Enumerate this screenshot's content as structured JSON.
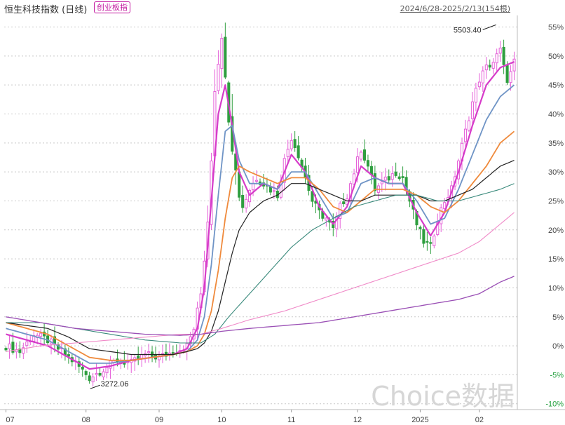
{
  "header": {
    "title": "恒生科技指数 (日线)",
    "badge": "创业板指",
    "range": "2024/6/28-2025/2/13(154根)"
  },
  "watermark": "Choice数据",
  "colors": {
    "up": "#e55fd8",
    "down": "#2e9e3f",
    "ma5": "#d63bc9",
    "ma10": "#6f94c6",
    "ma20": "#ef8a3c",
    "ma30": "#222222",
    "ma60": "#3a8a7c",
    "ma120": "#f08ac8",
    "ma250": "#9a4fb5"
  },
  "chart_data": {
    "type": "candlestick",
    "x_unit": "trading day",
    "y_unit": "% change",
    "ylim": [
      -11,
      57
    ],
    "yticks": [
      {
        "v": 55,
        "label": "55%"
      },
      {
        "v": 50,
        "label": "50%"
      },
      {
        "v": 45,
        "label": "45%"
      },
      {
        "v": 40,
        "label": "40%"
      },
      {
        "v": 35,
        "label": "35%"
      },
      {
        "v": 30,
        "label": "30%"
      },
      {
        "v": 25,
        "label": "25%"
      },
      {
        "v": 20,
        "label": "20%"
      },
      {
        "v": 15,
        "label": "15%"
      },
      {
        "v": 10,
        "label": "10%"
      },
      {
        "v": 5,
        "label": "5%"
      },
      {
        "v": 0,
        "label": "0%"
      },
      {
        "v": -5,
        "label": "-5%"
      },
      {
        "v": -10,
        "label": "-10%"
      }
    ],
    "xticks": [
      {
        "i": 0,
        "label": "07"
      },
      {
        "i": 23,
        "label": "08"
      },
      {
        "i": 44,
        "label": "09"
      },
      {
        "i": 62,
        "label": "10"
      },
      {
        "i": 82,
        "label": "11"
      },
      {
        "i": 101,
        "label": "12"
      },
      {
        "i": 119,
        "label": "2025"
      },
      {
        "i": 136,
        "label": "02"
      }
    ],
    "grid": true,
    "annotations": [
      {
        "label": "5503.40",
        "i": 141,
        "v": 55.5,
        "kind": "high"
      },
      {
        "label": "3272.06",
        "i": 24,
        "v": -7.4,
        "kind": "low"
      }
    ],
    "close_path": [
      [
        0,
        0
      ],
      [
        4,
        -1
      ],
      [
        8,
        2
      ],
      [
        12,
        1
      ],
      [
        16,
        -1
      ],
      [
        20,
        -3
      ],
      [
        24,
        -5.5
      ],
      [
        28,
        -4
      ],
      [
        32,
        -2.5
      ],
      [
        36,
        -3
      ],
      [
        40,
        -1.5
      ],
      [
        44,
        -2
      ],
      [
        48,
        -1
      ],
      [
        50,
        -0.5
      ],
      [
        52,
        0
      ],
      [
        54,
        3
      ],
      [
        56,
        9
      ],
      [
        57,
        15
      ],
      [
        58,
        22
      ],
      [
        59,
        33
      ],
      [
        60,
        45
      ],
      [
        61,
        50
      ],
      [
        62,
        52
      ],
      [
        63,
        48
      ],
      [
        64,
        40
      ],
      [
        65,
        35
      ],
      [
        66,
        30
      ],
      [
        67,
        26
      ],
      [
        68,
        24
      ],
      [
        70,
        27
      ],
      [
        72,
        29
      ],
      [
        74,
        28
      ],
      [
        76,
        27
      ],
      [
        78,
        26
      ],
      [
        80,
        32
      ],
      [
        82,
        36
      ],
      [
        84,
        33
      ],
      [
        86,
        29
      ],
      [
        88,
        25
      ],
      [
        90,
        23
      ],
      [
        92,
        22
      ],
      [
        94,
        20
      ],
      [
        96,
        24
      ],
      [
        98,
        26
      ],
      [
        100,
        30
      ],
      [
        102,
        34
      ],
      [
        104,
        31
      ],
      [
        106,
        27
      ],
      [
        108,
        28
      ],
      [
        110,
        29
      ],
      [
        112,
        30
      ],
      [
        114,
        29
      ],
      [
        116,
        25
      ],
      [
        118,
        21
      ],
      [
        120,
        18
      ],
      [
        122,
        17
      ],
      [
        124,
        22
      ],
      [
        126,
        25
      ],
      [
        128,
        27
      ],
      [
        130,
        32
      ],
      [
        132,
        37
      ],
      [
        134,
        42
      ],
      [
        136,
        46
      ],
      [
        138,
        48
      ],
      [
        140,
        49
      ],
      [
        141,
        50
      ],
      [
        142,
        51
      ],
      [
        143,
        48
      ],
      [
        144,
        46
      ],
      [
        145,
        47
      ],
      [
        146,
        49
      ]
    ],
    "moving_averages": [
      {
        "key": "ma5",
        "points": [
          [
            0,
            2
          ],
          [
            6,
            1
          ],
          [
            12,
            0
          ],
          [
            18,
            -2
          ],
          [
            24,
            -4
          ],
          [
            30,
            -3.5
          ],
          [
            36,
            -2.5
          ],
          [
            42,
            -2
          ],
          [
            48,
            -1.5
          ],
          [
            52,
            -0.5
          ],
          [
            55,
            3
          ],
          [
            57,
            10
          ],
          [
            59,
            25
          ],
          [
            61,
            40
          ],
          [
            63,
            45
          ],
          [
            65,
            38
          ],
          [
            67,
            30
          ],
          [
            70,
            26
          ],
          [
            74,
            28
          ],
          [
            78,
            27
          ],
          [
            82,
            33
          ],
          [
            86,
            30
          ],
          [
            90,
            24
          ],
          [
            94,
            21
          ],
          [
            98,
            24
          ],
          [
            102,
            31
          ],
          [
            106,
            29
          ],
          [
            110,
            28
          ],
          [
            114,
            28
          ],
          [
            118,
            23
          ],
          [
            122,
            19
          ],
          [
            126,
            23
          ],
          [
            130,
            30
          ],
          [
            134,
            38
          ],
          [
            138,
            45
          ],
          [
            142,
            48
          ],
          [
            146,
            49
          ]
        ]
      },
      {
        "key": "ma10",
        "points": [
          [
            0,
            3
          ],
          [
            6,
            2
          ],
          [
            12,
            1
          ],
          [
            18,
            -1
          ],
          [
            24,
            -3
          ],
          [
            30,
            -3
          ],
          [
            36,
            -2.5
          ],
          [
            42,
            -2
          ],
          [
            48,
            -1.5
          ],
          [
            52,
            -1
          ],
          [
            55,
            1
          ],
          [
            57,
            5
          ],
          [
            59,
            14
          ],
          [
            61,
            26
          ],
          [
            63,
            37
          ],
          [
            65,
            38
          ],
          [
            67,
            32
          ],
          [
            70,
            28
          ],
          [
            74,
            28
          ],
          [
            78,
            27
          ],
          [
            82,
            30
          ],
          [
            86,
            30
          ],
          [
            90,
            26
          ],
          [
            94,
            22
          ],
          [
            98,
            23
          ],
          [
            102,
            28
          ],
          [
            106,
            29
          ],
          [
            110,
            28
          ],
          [
            114,
            28
          ],
          [
            118,
            25
          ],
          [
            122,
            21
          ],
          [
            126,
            22
          ],
          [
            130,
            27
          ],
          [
            134,
            33
          ],
          [
            138,
            39
          ],
          [
            142,
            43
          ],
          [
            146,
            45
          ]
        ]
      },
      {
        "key": "ma20",
        "points": [
          [
            0,
            4
          ],
          [
            6,
            3
          ],
          [
            12,
            2
          ],
          [
            18,
            0
          ],
          [
            24,
            -2
          ],
          [
            30,
            -2.5
          ],
          [
            36,
            -2.5
          ],
          [
            42,
            -2
          ],
          [
            48,
            -1.5
          ],
          [
            52,
            -1
          ],
          [
            55,
            0
          ],
          [
            57,
            2
          ],
          [
            59,
            6
          ],
          [
            61,
            13
          ],
          [
            63,
            22
          ],
          [
            65,
            29
          ],
          [
            67,
            31
          ],
          [
            70,
            30
          ],
          [
            74,
            29
          ],
          [
            78,
            28
          ],
          [
            82,
            29
          ],
          [
            86,
            29
          ],
          [
            90,
            27
          ],
          [
            94,
            24
          ],
          [
            98,
            23
          ],
          [
            102,
            25
          ],
          [
            106,
            27
          ],
          [
            110,
            27
          ],
          [
            114,
            27
          ],
          [
            118,
            26
          ],
          [
            122,
            24
          ],
          [
            126,
            23
          ],
          [
            130,
            25
          ],
          [
            134,
            28
          ],
          [
            138,
            31
          ],
          [
            142,
            35
          ],
          [
            146,
            37
          ]
        ]
      },
      {
        "key": "ma30",
        "points": [
          [
            0,
            4
          ],
          [
            6,
            3.5
          ],
          [
            12,
            3
          ],
          [
            18,
            1.5
          ],
          [
            24,
            -0.5
          ],
          [
            30,
            -1
          ],
          [
            36,
            -1.5
          ],
          [
            42,
            -1.5
          ],
          [
            48,
            -1.5
          ],
          [
            52,
            -1
          ],
          [
            55,
            -0.5
          ],
          [
            57,
            0.5
          ],
          [
            59,
            2.5
          ],
          [
            61,
            6
          ],
          [
            63,
            11
          ],
          [
            65,
            16
          ],
          [
            67,
            20
          ],
          [
            70,
            23
          ],
          [
            74,
            25
          ],
          [
            78,
            26
          ],
          [
            82,
            28
          ],
          [
            86,
            28
          ],
          [
            90,
            27
          ],
          [
            94,
            26
          ],
          [
            98,
            25
          ],
          [
            102,
            25
          ],
          [
            106,
            26
          ],
          [
            110,
            26
          ],
          [
            114,
            26
          ],
          [
            118,
            26
          ],
          [
            122,
            25
          ],
          [
            126,
            25
          ],
          [
            130,
            26
          ],
          [
            134,
            27
          ],
          [
            138,
            29
          ],
          [
            142,
            31
          ],
          [
            146,
            32
          ]
        ]
      },
      {
        "key": "ma60",
        "points": [
          [
            0,
            4
          ],
          [
            10,
            4
          ],
          [
            20,
            3
          ],
          [
            30,
            2
          ],
          [
            40,
            1
          ],
          [
            50,
            0.5
          ],
          [
            56,
            0.5
          ],
          [
            60,
            2
          ],
          [
            64,
            5
          ],
          [
            70,
            9
          ],
          [
            76,
            13
          ],
          [
            82,
            17
          ],
          [
            88,
            20
          ],
          [
            94,
            22
          ],
          [
            100,
            24
          ],
          [
            106,
            25
          ],
          [
            112,
            26
          ],
          [
            118,
            26
          ],
          [
            124,
            25
          ],
          [
            130,
            25
          ],
          [
            136,
            26
          ],
          [
            142,
            27
          ],
          [
            146,
            28
          ]
        ]
      },
      {
        "key": "ma120",
        "points": [
          [
            0,
            -1
          ],
          [
            10,
            0
          ],
          [
            20,
            0.5
          ],
          [
            30,
            1
          ],
          [
            40,
            1.5
          ],
          [
            50,
            2
          ],
          [
            56,
            2
          ],
          [
            62,
            3
          ],
          [
            70,
            4.5
          ],
          [
            80,
            6
          ],
          [
            90,
            8
          ],
          [
            100,
            10
          ],
          [
            110,
            12
          ],
          [
            120,
            14
          ],
          [
            130,
            16
          ],
          [
            136,
            18
          ],
          [
            142,
            21
          ],
          [
            146,
            23
          ]
        ]
      },
      {
        "key": "ma250",
        "points": [
          [
            0,
            5
          ],
          [
            10,
            4
          ],
          [
            20,
            3
          ],
          [
            30,
            2.5
          ],
          [
            40,
            2
          ],
          [
            50,
            1.8
          ],
          [
            56,
            2
          ],
          [
            62,
            2.5
          ],
          [
            70,
            3
          ],
          [
            80,
            3.5
          ],
          [
            90,
            4
          ],
          [
            100,
            5
          ],
          [
            110,
            6
          ],
          [
            120,
            7
          ],
          [
            130,
            8
          ],
          [
            136,
            9
          ],
          [
            142,
            11
          ],
          [
            146,
            12
          ]
        ]
      }
    ]
  }
}
